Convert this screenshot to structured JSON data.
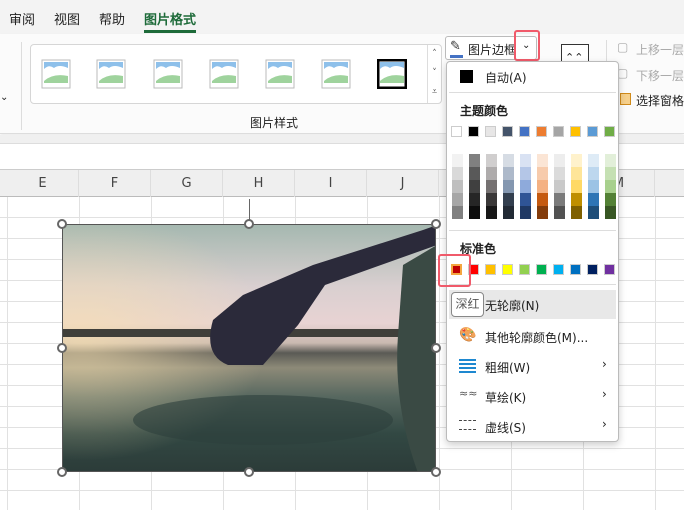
{
  "tabs": [
    {
      "label": "审阅"
    },
    {
      "label": "视图"
    },
    {
      "label": "帮助"
    },
    {
      "label": "图片格式",
      "active": true
    }
  ],
  "ribbon": {
    "group_label": "图片样式",
    "picture_border_label": "图片边框",
    "bring_forward": "上移一层",
    "send_backward": "下移一层",
    "selection_pane": "选择窗格"
  },
  "columns": [
    "E",
    "F",
    "G",
    "H",
    "I",
    "J",
    "",
    "",
    "M"
  ],
  "menu": {
    "auto": "自动(A)",
    "theme_colors_label": "主题颜色",
    "theme_colors": [
      "#ffffff",
      "#000000",
      "#e7e6e6",
      "#44546a",
      "#4472c4",
      "#ed7d31",
      "#a5a5a5",
      "#ffc000",
      "#5b9bd5",
      "#70ad47"
    ],
    "theme_shades": [
      [
        "#f2f2f2",
        "#d9d9d9",
        "#bfbfbf",
        "#a6a6a6",
        "#808080"
      ],
      [
        "#808080",
        "#595959",
        "#404040",
        "#262626",
        "#0d0d0d"
      ],
      [
        "#d0cece",
        "#aeabab",
        "#757171",
        "#3a3838",
        "#171717"
      ],
      [
        "#d6dce4",
        "#adb9ca",
        "#8497b0",
        "#333f4f",
        "#222a35"
      ],
      [
        "#d9e2f3",
        "#b4c6e7",
        "#8eaadb",
        "#2f5496",
        "#1f3864"
      ],
      [
        "#fbe5d5",
        "#f7cbac",
        "#f4b183",
        "#c55a11",
        "#843c0b"
      ],
      [
        "#ededed",
        "#dbdbdb",
        "#c9c9c9",
        "#7b7b7b",
        "#525252"
      ],
      [
        "#fff2cc",
        "#fee599",
        "#ffd965",
        "#bf8f00",
        "#7f6000"
      ],
      [
        "#deebf6",
        "#bdd7ee",
        "#9cc3e5",
        "#2e75b5",
        "#1e4e79"
      ],
      [
        "#e2efd9",
        "#c5e0b3",
        "#a8d08d",
        "#538135",
        "#375623"
      ]
    ],
    "standard_colors_label": "标准色",
    "standard_colors": [
      "#c00000",
      "#ff0000",
      "#ffc000",
      "#ffff00",
      "#92d050",
      "#00b050",
      "#00b0f0",
      "#0070c0",
      "#002060",
      "#7030a0"
    ],
    "tooltip": "深红",
    "no_outline": "无轮廓(N)",
    "more_colors": "其他轮廓颜色(M)...",
    "weight": "粗细(W)",
    "sketch": "草绘(K)",
    "dashes": "虚线(S)"
  }
}
